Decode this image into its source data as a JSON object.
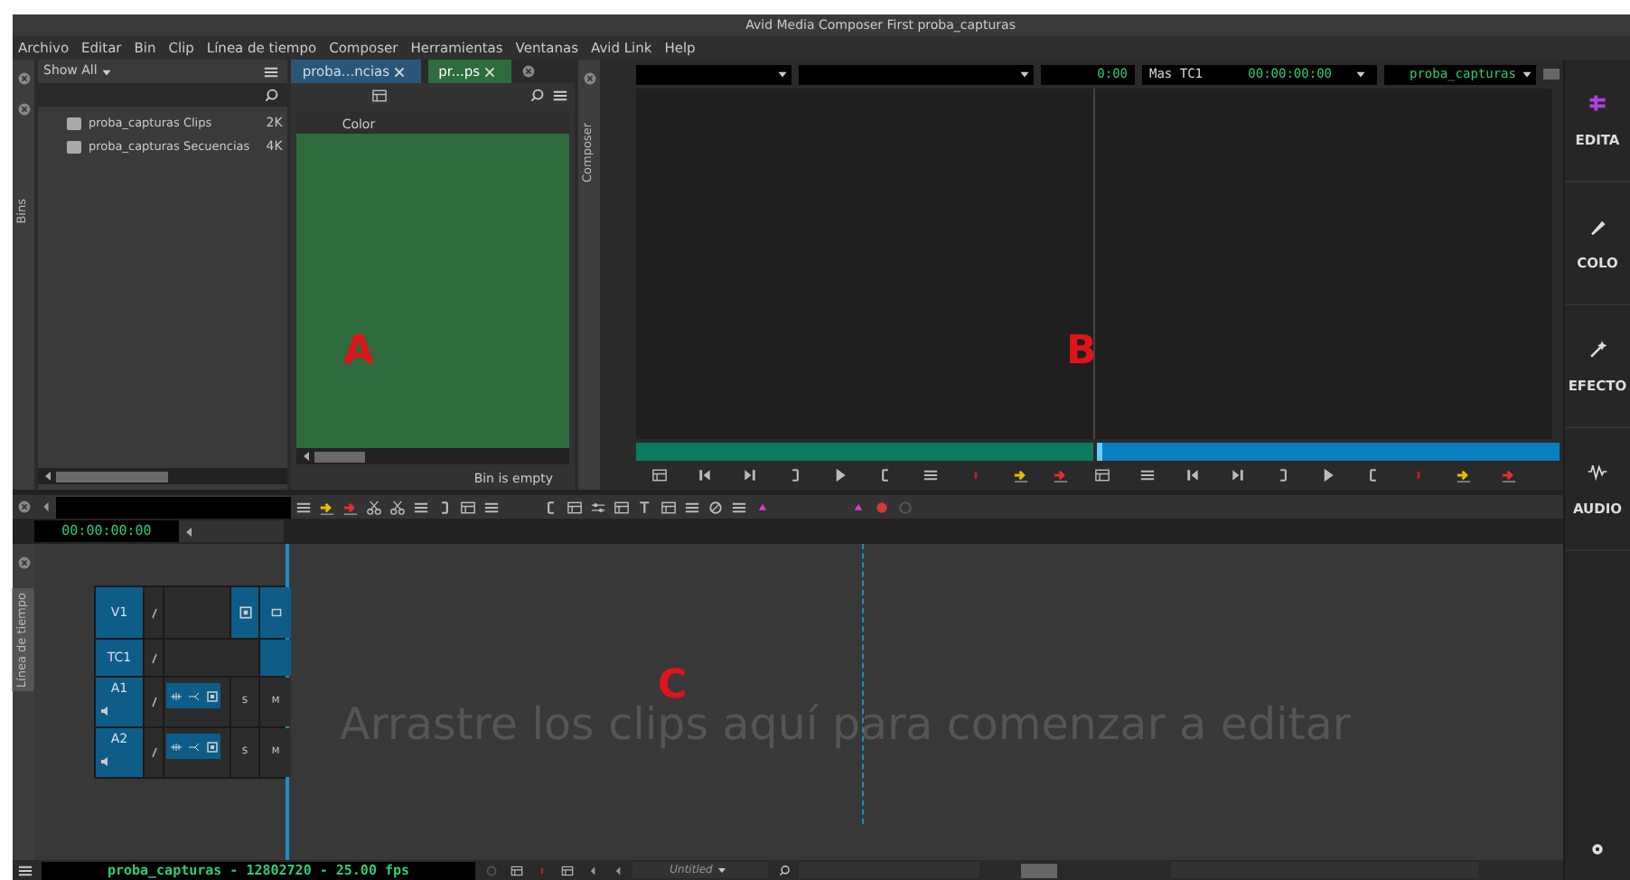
{
  "window": {
    "title": "Avid Media Composer First  proba_capturas"
  },
  "menu": [
    "Archivo",
    "Editar",
    "Bin",
    "Clip",
    "Línea de tiempo",
    "Composer",
    "Herramientas",
    "Ventanas",
    "Avid Link",
    "Help"
  ],
  "bins": {
    "side_label": "Bins",
    "filter": "Show All",
    "items": [
      {
        "name": "proba_capturas Clips",
        "size": "2K"
      },
      {
        "name": "proba_capturas Secuencias",
        "size": "4K"
      }
    ]
  },
  "bin_window": {
    "tabs": [
      {
        "label": "proba...ncias",
        "selected": false,
        "color": "#2c5677"
      },
      {
        "label": "pr...ps",
        "selected": true,
        "color": "#2e6b3d"
      }
    ],
    "column": "Color",
    "status": "Bin is empty"
  },
  "composer": {
    "side_label": "Composer",
    "duration": "0:00",
    "tc_label": "Mas TC1",
    "timecode": "00:00:00:00",
    "sequence": "proba_capturas"
  },
  "workspaces": [
    "EDITA",
    "COLO",
    "EFECTO",
    "AUDIO"
  ],
  "timeline": {
    "side_label": "Línea de tiempo",
    "timecode": "00:00:00:00",
    "tracks": [
      {
        "label": "V1",
        "kind": "video"
      },
      {
        "label": "TC1",
        "kind": "timecode"
      },
      {
        "label": "A1",
        "kind": "audio",
        "solo": "S",
        "mute": "M"
      },
      {
        "label": "A2",
        "kind": "audio",
        "solo": "S",
        "mute": "M"
      }
    ],
    "hint": "Arrastre los clips aquí para comenzar a editar",
    "sequence_info": "proba_capturas - 12802720 - 25.00 fps",
    "sequence_name": "Untitled"
  },
  "annotations": [
    {
      "text": "A"
    },
    {
      "text": "B"
    },
    {
      "text": "C"
    }
  ]
}
